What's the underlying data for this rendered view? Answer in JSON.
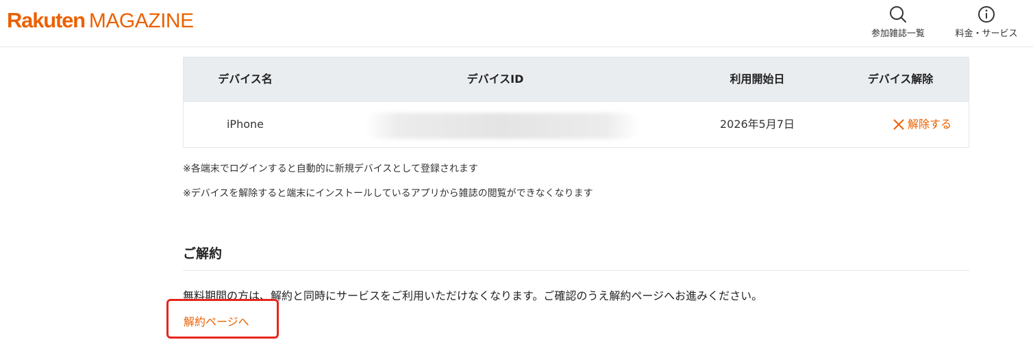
{
  "header": {
    "logo_primary": "Rakuten",
    "logo_secondary": "MAGAZINE",
    "nav": [
      {
        "label": "参加雑誌一覧",
        "icon": "search-icon"
      },
      {
        "label": "料金・サービス",
        "icon": "info-icon"
      }
    ]
  },
  "devices": {
    "columns": [
      "デバイス名",
      "デバイスID",
      "利用開始日",
      "デバイス解除"
    ],
    "rows": [
      {
        "name": "iPhone",
        "device_id": "",
        "start_date": "2026年5月7日",
        "release_label": "解除する"
      }
    ],
    "notes": [
      "※各端末でログインすると自動的に新規デバイスとして登録されます",
      "※デバイスを解除すると端末にインストールしているアプリから雑誌の閲覧ができなくなります"
    ]
  },
  "cancellation": {
    "title": "ご解約",
    "description": "無料期間の方は、解約と同時にサービスをご利用いただけなくなります。ご確認のうえ解約ページへお進みください。",
    "link_label": "解約ページへ"
  },
  "colors": {
    "brand": "#eb6100",
    "table_header_bg": "#eaedf0",
    "highlight_border": "#e8251c"
  }
}
